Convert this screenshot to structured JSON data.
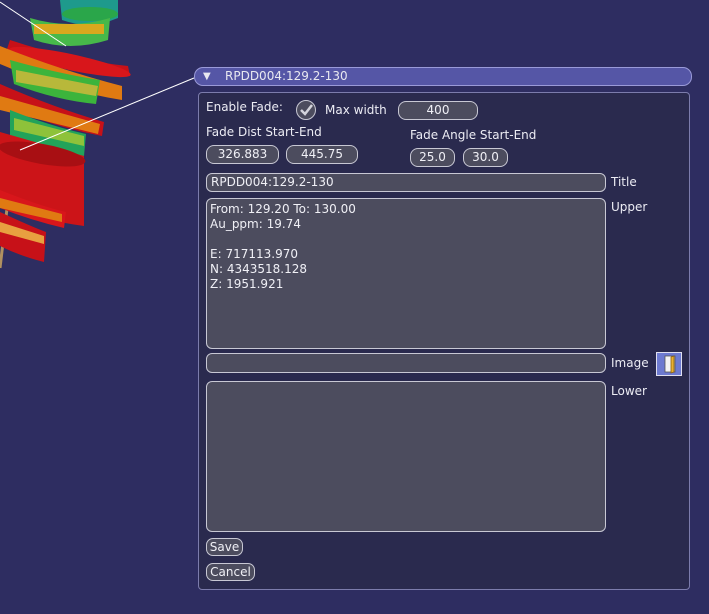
{
  "popup": {
    "header_title": "RPDD004:129.2-130",
    "enable_fade_label": "Enable Fade:",
    "max_width_label": "Max width",
    "max_width_value": "400",
    "fade_dist_label": "Fade Dist Start-End",
    "fade_dist_start": "326.883",
    "fade_dist_end": "445.75",
    "fade_angle_label": "Fade Angle Start-End",
    "fade_angle_start": "25.0",
    "fade_angle_end": "30.0",
    "title_value": "RPDD004:129.2-130",
    "title_label": "Title",
    "upper_text": "From: 129.20 To: 130.00\nAu_ppm: 19.74\n\nE: 717113.970\nN: 4343518.128\nZ: 1951.921",
    "upper_label": "Upper",
    "image_value": "",
    "image_label": "Image",
    "lower_text": "",
    "lower_label": "Lower",
    "save_label": "Save",
    "cancel_label": "Cancel"
  },
  "icons": {
    "collapse": "triangle-down-icon",
    "enable_fade_check": "checkmark-icon",
    "image_browse": "folder-open-icon"
  },
  "colors": {
    "background": "#2e2d61",
    "header": "#5556a6",
    "panel": "#2a2a4e",
    "field": "#4c4c5e",
    "drillhole_red": "#cc1418",
    "drillhole_orange": "#e07a12",
    "drillhole_green": "#3cb43c",
    "drillhole_teal": "#1e9a8c"
  }
}
